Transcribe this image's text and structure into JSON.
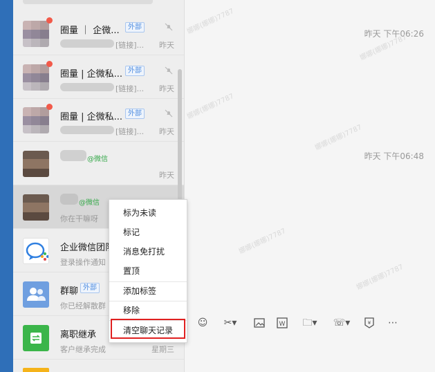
{
  "chat_list": [
    {
      "name": "圈量 ｜ 企微...",
      "ext_tag": "外部",
      "preview": "[链接]...",
      "time": "昨天",
      "muted": true,
      "unread_dot": true
    },
    {
      "name": "圈量 | 企微私...",
      "ext_tag": "外部",
      "preview": "[链接]...",
      "time": "昨天",
      "muted": true,
      "unread_dot": true
    },
    {
      "name": "圈量 | 企微私...",
      "ext_tag": "外部",
      "preview": "[链接]...",
      "time": "昨天",
      "muted": true,
      "unread_dot": true
    },
    {
      "name": "",
      "wechat_tag": "@微信",
      "preview": "",
      "time": "昨天"
    },
    {
      "name": "",
      "wechat_tag": "@微信",
      "preview": "你在干嘛呀",
      "time": ""
    },
    {
      "name": "企业微信团队",
      "preview": "登录操作通知",
      "time": ""
    },
    {
      "name": "群聊",
      "ext_tag": "外部",
      "preview": "你已经解散群",
      "time": ""
    },
    {
      "name": "离职继承",
      "preview": "客户继承完成",
      "time": "星期三"
    },
    {
      "name": "",
      "preview": "",
      "time": ""
    }
  ],
  "chat_area": {
    "timestamps": [
      "昨天 下午06:26",
      "昨天 下午06:48"
    ],
    "watermark": "娜娜(娜娜)7787"
  },
  "context_menu": {
    "items": [
      "标为未读",
      "标记",
      "消息免打扰",
      "置顶",
      "添加标签",
      "移除",
      "清空聊天记录"
    ],
    "highlighted": "清空聊天记录"
  },
  "toolbar_icons": [
    "emoji-icon",
    "scissors-icon",
    "image-icon",
    "word-doc-icon",
    "folder-icon",
    "phone-icon",
    "red-packet-icon",
    "more-icon"
  ],
  "colors": {
    "sidebar": "#2f6fb8",
    "highlight_border": "#e02020",
    "external_tag": "#4f8de0",
    "wechat_tag": "#36a84a"
  }
}
